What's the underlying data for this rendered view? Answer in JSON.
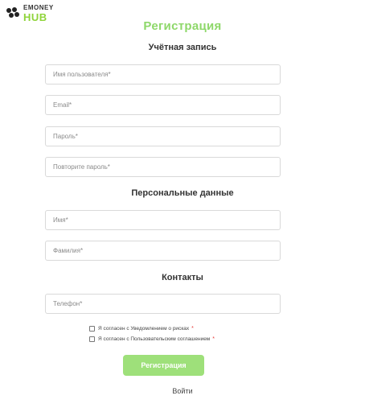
{
  "brand": {
    "top": "EMONEY",
    "bottom": "HUB"
  },
  "title": "Регистрация",
  "sections": {
    "account": "Учётная запись",
    "personal": "Персональные данные",
    "contacts": "Контакты"
  },
  "fields": {
    "username": {
      "placeholder": "Имя пользователя*",
      "value": ""
    },
    "email": {
      "placeholder": "Email*",
      "value": ""
    },
    "password": {
      "placeholder": "Пароль*",
      "value": ""
    },
    "password_repeat": {
      "placeholder": "Повторите пароль*",
      "value": ""
    },
    "first_name": {
      "placeholder": "Имя*",
      "value": ""
    },
    "last_name": {
      "placeholder": "Фамилия*",
      "value": ""
    },
    "phone": {
      "placeholder": "Телефон*",
      "value": ""
    }
  },
  "agreements": [
    {
      "label": "Я согласен с Уведомлением о рисках",
      "required": "*",
      "checked": false
    },
    {
      "label": "Я согласен с Пользовательским соглашением",
      "required": "*",
      "checked": false
    }
  ],
  "submit_label": "Регистрация",
  "login_link": "Войти",
  "colors": {
    "accent": "#8ed86a",
    "button": "#9ee07a",
    "required": "#e53935"
  }
}
